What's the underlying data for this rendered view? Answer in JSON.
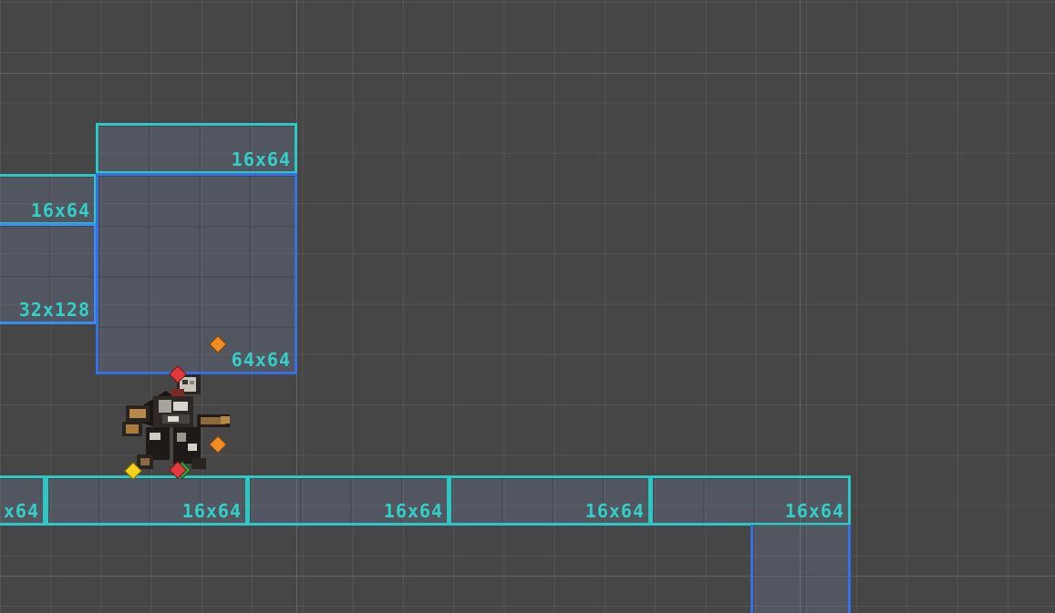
{
  "scene": {
    "tiles": [
      {
        "id": "tile-top",
        "label": "16x64"
      },
      {
        "id": "tile-left-upper",
        "label": "16x64"
      },
      {
        "id": "tile-left-lower",
        "label": "32x128"
      },
      {
        "id": "tile-big",
        "label": "64x64"
      },
      {
        "id": "tile-floor-1",
        "label": "x64"
      },
      {
        "id": "tile-floor-2",
        "label": "16x64"
      },
      {
        "id": "tile-floor-3",
        "label": "16x64"
      },
      {
        "id": "tile-floor-4",
        "label": "16x64"
      },
      {
        "id": "tile-floor-5",
        "label": "16x64"
      },
      {
        "id": "tile-drop",
        "label": ""
      }
    ],
    "character": {
      "icon": "player-warrior-sprite"
    },
    "handles": [
      {
        "icon": "gizmo-handle-icon",
        "color": "#e23a3a"
      },
      {
        "icon": "gizmo-handle-icon",
        "color": "#f08c22"
      },
      {
        "icon": "gizmo-handle-icon",
        "color": "#f5d21c"
      },
      {
        "icon": "gizmo-handle-icon",
        "color": "#2fa03a"
      }
    ],
    "colors": {
      "background": "#464646",
      "collider_cyan": "#2ec8c4",
      "collider_blue": "#3a6fe0",
      "label": "#33d0c8"
    }
  }
}
